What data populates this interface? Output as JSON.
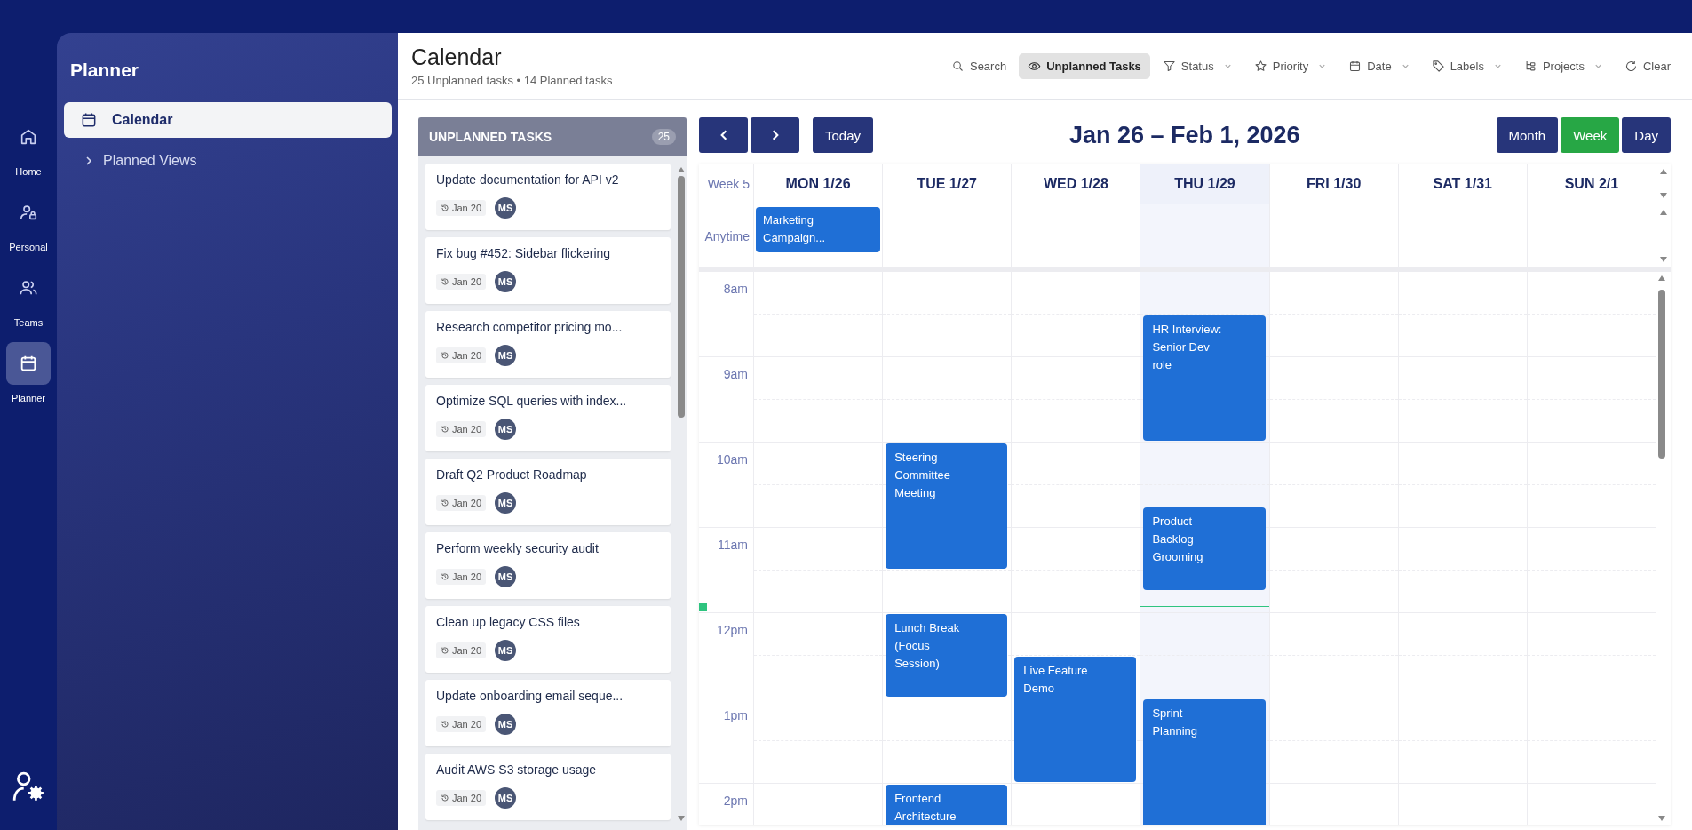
{
  "rail": [
    {
      "label": "Home",
      "selected": false
    },
    {
      "label": "Personal",
      "selected": false
    },
    {
      "label": "Teams",
      "selected": false
    },
    {
      "label": "Planner",
      "selected": true
    }
  ],
  "sidebar": {
    "title": "Planner",
    "items": [
      {
        "label": "Calendar",
        "kind": "link",
        "selected": true
      },
      {
        "label": "Planned Views",
        "kind": "group",
        "expanded": false,
        "selected": false
      }
    ]
  },
  "header": {
    "title": "Calendar",
    "subtitle": "25 Unplanned tasks • 14 Planned tasks"
  },
  "toolbar": [
    {
      "label": "Search",
      "kind": "button",
      "selected": false
    },
    {
      "label": "Unplanned Tasks",
      "kind": "toggle",
      "selected": true
    },
    {
      "label": "Status",
      "kind": "dropdown",
      "selected": false
    },
    {
      "label": "Priority",
      "kind": "dropdown",
      "selected": false
    },
    {
      "label": "Date",
      "kind": "dropdown",
      "selected": false
    },
    {
      "label": "Labels",
      "kind": "dropdown",
      "selected": false
    },
    {
      "label": "Projects",
      "kind": "dropdown",
      "selected": false
    },
    {
      "label": "Clear",
      "kind": "button",
      "selected": false
    }
  ],
  "unplanned": {
    "title": "UNPLANNED TASKS",
    "count": "25",
    "tasks": [
      {
        "title": "Update documentation for API v2",
        "date": "Jan 20",
        "assignee": "MS"
      },
      {
        "title": "Fix bug #452: Sidebar flickering",
        "date": "Jan 20",
        "assignee": "MS"
      },
      {
        "title": "Research competitor pricing mo...",
        "date": "Jan 20",
        "assignee": "MS"
      },
      {
        "title": "Optimize SQL queries with index...",
        "date": "Jan 20",
        "assignee": "MS"
      },
      {
        "title": "Draft Q2 Product Roadmap",
        "date": "Jan 20",
        "assignee": "MS"
      },
      {
        "title": "Perform weekly security audit",
        "date": "Jan 20",
        "assignee": "MS"
      },
      {
        "title": "Clean up legacy CSS files",
        "date": "Jan 20",
        "assignee": "MS"
      },
      {
        "title": "Update onboarding email seque...",
        "date": "Jan 20",
        "assignee": "MS"
      },
      {
        "title": "Audit AWS S3 storage usage",
        "date": "Jan 20",
        "assignee": "MS"
      }
    ]
  },
  "calendar": {
    "today_button": "Today",
    "range": "Jan 26 – Feb 1, 2026",
    "views": [
      {
        "label": "Month",
        "selected": false
      },
      {
        "label": "Week",
        "selected": true
      },
      {
        "label": "Day",
        "selected": false
      }
    ],
    "week_label": "Week 5",
    "anytime_label": "Anytime",
    "hours": [
      "8am",
      "9am",
      "10am",
      "11am",
      "12pm",
      "1pm",
      "2pm"
    ],
    "days": [
      {
        "label": "MON 1/26",
        "today": false,
        "anytime": [
          "Marketing Campaign..."
        ]
      },
      {
        "label": "TUE 1/27",
        "today": false,
        "events": [
          "Steering Committee Meeting",
          "Lunch Break (Focus Session)",
          "Frontend Architecture"
        ]
      },
      {
        "label": "WED 1/28",
        "today": false,
        "events": [
          "Live Feature Demo"
        ]
      },
      {
        "label": "THU 1/29",
        "today": true,
        "events": [
          "HR Interview: Senior Dev role",
          "Product Backlog Grooming",
          "Sprint Planning"
        ]
      },
      {
        "label": "FRI 1/30",
        "today": false
      },
      {
        "label": "SAT 1/31",
        "today": false
      },
      {
        "label": "SUN 2/1",
        "today": false
      }
    ]
  }
}
